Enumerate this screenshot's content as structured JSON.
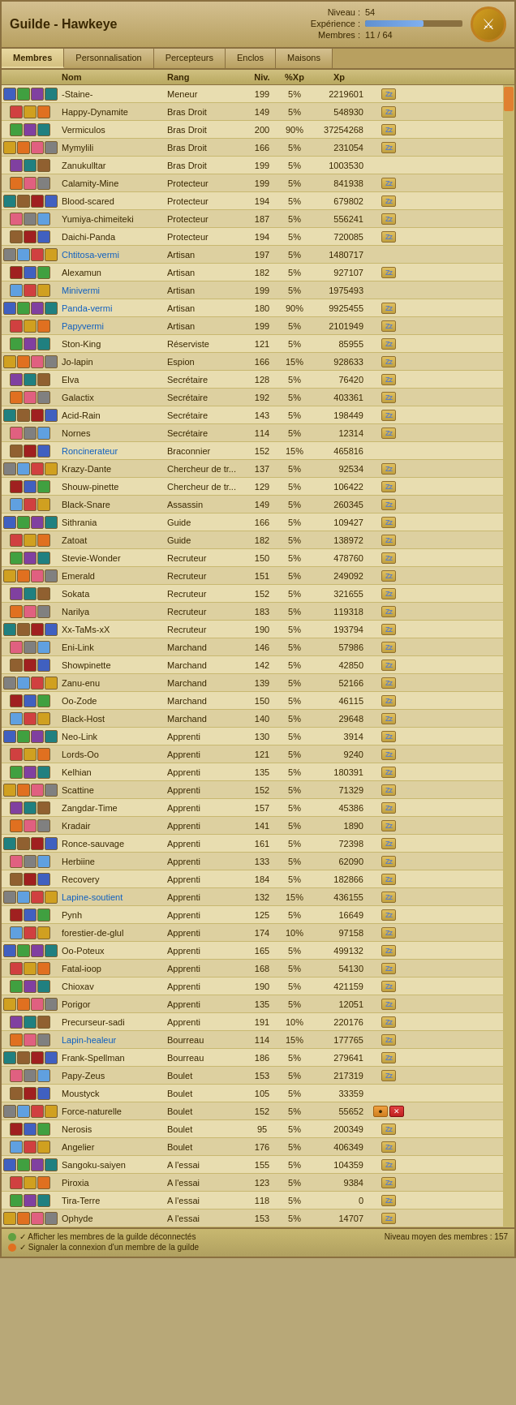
{
  "header": {
    "title": "Guilde - Hawkeye",
    "niveau_label": "Niveau :",
    "niveau_value": "54",
    "experience_label": "Expérience :",
    "xp_bar_pct": 60,
    "membres_label": "Membres :",
    "membres_value": "11 / 64"
  },
  "tabs": [
    {
      "label": "Membres",
      "active": true
    },
    {
      "label": "Personnalisation",
      "active": false
    },
    {
      "label": "Percepteurs",
      "active": false
    },
    {
      "label": "Enclos",
      "active": false
    },
    {
      "label": "Maisons",
      "active": false
    }
  ],
  "table": {
    "headers": [
      "Nom",
      "Rang",
      "Niv.",
      "%Xp",
      "Xp"
    ],
    "rows": [
      {
        "name": "-Staine-",
        "rang": "Meneur",
        "niv": 199,
        "xp_pct": "5%",
        "xp": "2219601",
        "link": false,
        "action": "zz"
      },
      {
        "name": "Happy-Dynamite",
        "rang": "Bras Droit",
        "niv": 149,
        "xp_pct": "5%",
        "xp": "548930",
        "link": false,
        "action": "zz"
      },
      {
        "name": "Vermiculos",
        "rang": "Bras Droit",
        "niv": 200,
        "xp_pct": "90%",
        "xp": "37254268",
        "link": false,
        "action": "zz"
      },
      {
        "name": "Mymylili",
        "rang": "Bras Droit",
        "niv": 166,
        "xp_pct": "5%",
        "xp": "231054",
        "link": false,
        "action": "zz"
      },
      {
        "name": "Zanukulltar",
        "rang": "Bras Droit",
        "niv": 199,
        "xp_pct": "5%",
        "xp": "1003530",
        "link": false,
        "action": ""
      },
      {
        "name": "Calamity-Mine",
        "rang": "Protecteur",
        "niv": 199,
        "xp_pct": "5%",
        "xp": "841938",
        "link": false,
        "action": "zz"
      },
      {
        "name": "Blood-scared",
        "rang": "Protecteur",
        "niv": 194,
        "xp_pct": "5%",
        "xp": "679802",
        "link": false,
        "action": "zz"
      },
      {
        "name": "Yumiya-chimeiteki",
        "rang": "Protecteur",
        "niv": 187,
        "xp_pct": "5%",
        "xp": "556241",
        "link": false,
        "action": "zz"
      },
      {
        "name": "Daichi-Panda",
        "rang": "Protecteur",
        "niv": 194,
        "xp_pct": "5%",
        "xp": "720085",
        "link": false,
        "action": "zz"
      },
      {
        "name": "Chtitosa-vermi",
        "rang": "Artisan",
        "niv": 197,
        "xp_pct": "5%",
        "xp": "1480717",
        "link": true,
        "action": ""
      },
      {
        "name": "Alexamun",
        "rang": "Artisan",
        "niv": 182,
        "xp_pct": "5%",
        "xp": "927107",
        "link": false,
        "action": "zz"
      },
      {
        "name": "Minivermi",
        "rang": "Artisan",
        "niv": 199,
        "xp_pct": "5%",
        "xp": "1975493",
        "link": true,
        "action": ""
      },
      {
        "name": "Panda-vermi",
        "rang": "Artisan",
        "niv": 180,
        "xp_pct": "90%",
        "xp": "9925455",
        "link": true,
        "action": "zz"
      },
      {
        "name": "Papyvermi",
        "rang": "Artisan",
        "niv": 199,
        "xp_pct": "5%",
        "xp": "2101949",
        "link": true,
        "action": "zz"
      },
      {
        "name": "Ston-King",
        "rang": "Réserviste",
        "niv": 121,
        "xp_pct": "5%",
        "xp": "85955",
        "link": false,
        "action": "zz"
      },
      {
        "name": "Jo-lapin",
        "rang": "Espion",
        "niv": 166,
        "xp_pct": "15%",
        "xp": "928633",
        "link": false,
        "action": "zz"
      },
      {
        "name": "Elva",
        "rang": "Secrétaire",
        "niv": 128,
        "xp_pct": "5%",
        "xp": "76420",
        "link": false,
        "action": "zz"
      },
      {
        "name": "Galactix",
        "rang": "Secrétaire",
        "niv": 192,
        "xp_pct": "5%",
        "xp": "403361",
        "link": false,
        "action": "zz"
      },
      {
        "name": "Acid-Rain",
        "rang": "Secrétaire",
        "niv": 143,
        "xp_pct": "5%",
        "xp": "198449",
        "link": false,
        "action": "zz"
      },
      {
        "name": "Nornes",
        "rang": "Secrétaire",
        "niv": 114,
        "xp_pct": "5%",
        "xp": "12314",
        "link": false,
        "action": "zz"
      },
      {
        "name": "Roncinerateur",
        "rang": "Braconnier",
        "niv": 152,
        "xp_pct": "15%",
        "xp": "465816",
        "link": true,
        "action": ""
      },
      {
        "name": "Krazy-Dante",
        "rang": "Chercheur de tr...",
        "niv": 137,
        "xp_pct": "5%",
        "xp": "92534",
        "link": false,
        "action": "zz"
      },
      {
        "name": "Shouw-pinette",
        "rang": "Chercheur de tr...",
        "niv": 129,
        "xp_pct": "5%",
        "xp": "106422",
        "link": false,
        "action": "zz"
      },
      {
        "name": "Black-Snare",
        "rang": "Assassin",
        "niv": 149,
        "xp_pct": "5%",
        "xp": "260345",
        "link": false,
        "action": "zz"
      },
      {
        "name": "Sithrania",
        "rang": "Guide",
        "niv": 166,
        "xp_pct": "5%",
        "xp": "109427",
        "link": false,
        "action": "zz"
      },
      {
        "name": "Zatoat",
        "rang": "Guide",
        "niv": 182,
        "xp_pct": "5%",
        "xp": "138972",
        "link": false,
        "action": "zz"
      },
      {
        "name": "Stevie-Wonder",
        "rang": "Recruteur",
        "niv": 150,
        "xp_pct": "5%",
        "xp": "478760",
        "link": false,
        "action": "zz"
      },
      {
        "name": "Emerald",
        "rang": "Recruteur",
        "niv": 151,
        "xp_pct": "5%",
        "xp": "249092",
        "link": false,
        "action": "zz"
      },
      {
        "name": "Sokata",
        "rang": "Recruteur",
        "niv": 152,
        "xp_pct": "5%",
        "xp": "321655",
        "link": false,
        "action": "zz"
      },
      {
        "name": "Narilya",
        "rang": "Recruteur",
        "niv": 183,
        "xp_pct": "5%",
        "xp": "119318",
        "link": false,
        "action": "zz"
      },
      {
        "name": "Xx-TaMs-xX",
        "rang": "Recruteur",
        "niv": 190,
        "xp_pct": "5%",
        "xp": "193794",
        "link": false,
        "action": "zz"
      },
      {
        "name": "Eni-Link",
        "rang": "Marchand",
        "niv": 146,
        "xp_pct": "5%",
        "xp": "57986",
        "link": false,
        "action": "zz"
      },
      {
        "name": "Showpinette",
        "rang": "Marchand",
        "niv": 142,
        "xp_pct": "5%",
        "xp": "42850",
        "link": false,
        "action": "zz"
      },
      {
        "name": "Zanu-enu",
        "rang": "Marchand",
        "niv": 139,
        "xp_pct": "5%",
        "xp": "52166",
        "link": false,
        "action": "zz"
      },
      {
        "name": "Oo-Zode",
        "rang": "Marchand",
        "niv": 150,
        "xp_pct": "5%",
        "xp": "46115",
        "link": false,
        "action": "zz"
      },
      {
        "name": "Black-Host",
        "rang": "Marchand",
        "niv": 140,
        "xp_pct": "5%",
        "xp": "29648",
        "link": false,
        "action": "zz"
      },
      {
        "name": "Neo-Link",
        "rang": "Apprenti",
        "niv": 130,
        "xp_pct": "5%",
        "xp": "3914",
        "link": false,
        "action": "zz"
      },
      {
        "name": "Lords-Oo",
        "rang": "Apprenti",
        "niv": 121,
        "xp_pct": "5%",
        "xp": "9240",
        "link": false,
        "action": "zz"
      },
      {
        "name": "Kelhian",
        "rang": "Apprenti",
        "niv": 135,
        "xp_pct": "5%",
        "xp": "180391",
        "link": false,
        "action": "zz"
      },
      {
        "name": "Scattine",
        "rang": "Apprenti",
        "niv": 152,
        "xp_pct": "5%",
        "xp": "71329",
        "link": false,
        "action": "zz"
      },
      {
        "name": "Zangdar-Time",
        "rang": "Apprenti",
        "niv": 157,
        "xp_pct": "5%",
        "xp": "45386",
        "link": false,
        "action": "zz"
      },
      {
        "name": "Kradair",
        "rang": "Apprenti",
        "niv": 141,
        "xp_pct": "5%",
        "xp": "1890",
        "link": false,
        "action": "zz"
      },
      {
        "name": "Ronce-sauvage",
        "rang": "Apprenti",
        "niv": 161,
        "xp_pct": "5%",
        "xp": "72398",
        "link": false,
        "action": "zz"
      },
      {
        "name": "Herbiine",
        "rang": "Apprenti",
        "niv": 133,
        "xp_pct": "5%",
        "xp": "62090",
        "link": false,
        "action": "zz"
      },
      {
        "name": "Recovery",
        "rang": "Apprenti",
        "niv": 184,
        "xp_pct": "5%",
        "xp": "182866",
        "link": false,
        "action": "zz"
      },
      {
        "name": "Lapine-soutient",
        "rang": "Apprenti",
        "niv": 132,
        "xp_pct": "15%",
        "xp": "436155",
        "link": true,
        "action": "zz"
      },
      {
        "name": "Pynh",
        "rang": "Apprenti",
        "niv": 125,
        "xp_pct": "5%",
        "xp": "16649",
        "link": false,
        "action": "zz"
      },
      {
        "name": "forestier-de-glul",
        "rang": "Apprenti",
        "niv": 174,
        "xp_pct": "10%",
        "xp": "97158",
        "link": false,
        "action": "zz"
      },
      {
        "name": "Oo-Poteux",
        "rang": "Apprenti",
        "niv": 165,
        "xp_pct": "5%",
        "xp": "499132",
        "link": false,
        "action": "zz"
      },
      {
        "name": "Fatal-ioop",
        "rang": "Apprenti",
        "niv": 168,
        "xp_pct": "5%",
        "xp": "54130",
        "link": false,
        "action": "zz"
      },
      {
        "name": "Chioxav",
        "rang": "Apprenti",
        "niv": 190,
        "xp_pct": "5%",
        "xp": "421159",
        "link": false,
        "action": "zz"
      },
      {
        "name": "Porigor",
        "rang": "Apprenti",
        "niv": 135,
        "xp_pct": "5%",
        "xp": "12051",
        "link": false,
        "action": "zz"
      },
      {
        "name": "Precurseur-sadi",
        "rang": "Apprenti",
        "niv": 191,
        "xp_pct": "10%",
        "xp": "220176",
        "link": false,
        "action": "zz"
      },
      {
        "name": "Lapin-healeur",
        "rang": "Bourreau",
        "niv": 114,
        "xp_pct": "15%",
        "xp": "177765",
        "link": true,
        "action": "zz"
      },
      {
        "name": "Frank-Spellman",
        "rang": "Bourreau",
        "niv": 186,
        "xp_pct": "5%",
        "xp": "279641",
        "link": false,
        "action": "zz"
      },
      {
        "name": "Papy-Zeus",
        "rang": "Boulet",
        "niv": 153,
        "xp_pct": "5%",
        "xp": "217319",
        "link": false,
        "action": "zz"
      },
      {
        "name": "Moustyck",
        "rang": "Boulet",
        "niv": 105,
        "xp_pct": "5%",
        "xp": "33359",
        "link": false,
        "action": ""
      },
      {
        "name": "Force-naturelle",
        "rang": "Boulet",
        "niv": 152,
        "xp_pct": "5%",
        "xp": "55652",
        "link": false,
        "action": "orange_x"
      },
      {
        "name": "Nerosis",
        "rang": "Boulet",
        "niv": 95,
        "xp_pct": "5%",
        "xp": "200349",
        "link": false,
        "action": "zz"
      },
      {
        "name": "Angelier",
        "rang": "Boulet",
        "niv": 176,
        "xp_pct": "5%",
        "xp": "406349",
        "link": false,
        "action": "zz"
      },
      {
        "name": "Sangoku-saiyen",
        "rang": "A l'essai",
        "niv": 155,
        "xp_pct": "5%",
        "xp": "104359",
        "link": false,
        "action": "zz"
      },
      {
        "name": "Piroxia",
        "rang": "A l'essai",
        "niv": 123,
        "xp_pct": "5%",
        "xp": "9384",
        "link": false,
        "action": "zz"
      },
      {
        "name": "Tira-Terre",
        "rang": "A l'essai",
        "niv": 118,
        "xp_pct": "5%",
        "xp": "0",
        "link": false,
        "action": "zz"
      },
      {
        "name": "Ophyde",
        "rang": "A l'essai",
        "niv": 153,
        "xp_pct": "5%",
        "xp": "14707",
        "link": false,
        "action": "zz"
      }
    ]
  },
  "footer": {
    "line1": "✓ Afficher les membres de la guilde déconnectés",
    "line2": "✓ Signaler la connexion d'un membre de la guilde",
    "right": "Niveau moyen des membres : 157"
  }
}
